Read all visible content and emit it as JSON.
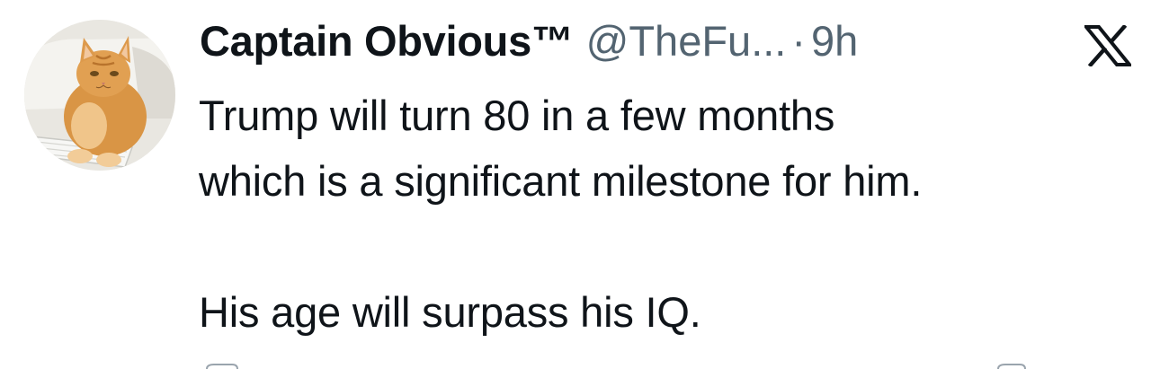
{
  "tweet": {
    "display_name": "Captain Obvious™",
    "handle": "@TheFu...",
    "separator": "·",
    "time_ago": "9h",
    "lines": [
      "Trump will turn 80 in a few months",
      "which is a significant milestone for him.",
      "His age will surpass his IQ."
    ]
  },
  "avatar": {
    "subject": "orange-cat-with-keyboard"
  },
  "icons": {
    "platform_logo": "x-logo-icon"
  },
  "colors": {
    "text_primary": "#0f1419",
    "text_secondary": "#536471",
    "background": "#ffffff"
  }
}
